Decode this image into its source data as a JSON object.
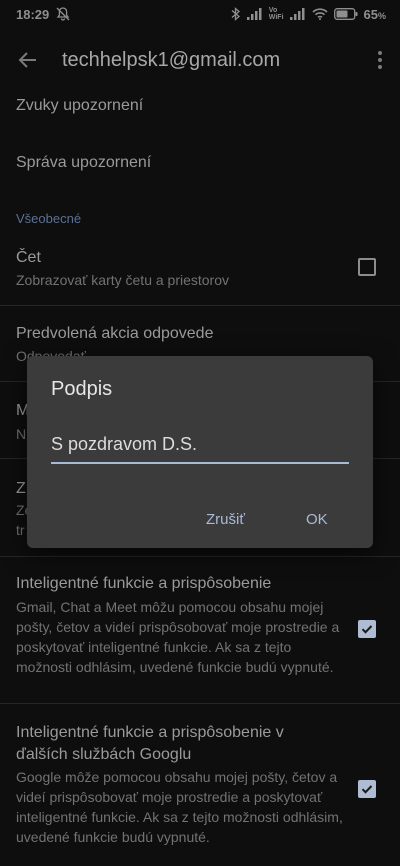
{
  "status_bar": {
    "time": "18:29",
    "icons": [
      "mute-bell-icon",
      "bluetooth-icon",
      "signal-icon",
      "vowifi-icon",
      "wifi-icon",
      "battery-icon"
    ],
    "battery_percent": "65",
    "battery_suffix": "%",
    "vowifi_label_1": "Vo",
    "vowifi_label_2": "WiFi"
  },
  "app_bar": {
    "title": "techhelpsk1@gmail.com"
  },
  "settings": {
    "notification_sounds": "Zvuky upozornení",
    "manage_notifications": "Správa upozornení",
    "section_general": "Všeobecné",
    "chat": {
      "title": "Čet",
      "subtitle": "Zobrazovať karty četu a priestorov",
      "checked": false
    },
    "default_reply": {
      "title": "Predvolená akcia odpovede",
      "subtitle": "Odpovedať"
    },
    "partial_m": "M",
    "partial_n": "N",
    "partial_z": "Z",
    "partial_ze": "Ze",
    "partial_tr": "tr",
    "smart_features": {
      "title": "Inteligentné funkcie a prispôsobenie",
      "subtitle": "Gmail, Chat a Meet môžu pomocou obsahu mojej pošty, četov a videí prispôsobovať moje prostredie a poskytovať inteligentné funkcie. Ak sa z tejto možnosti odhlásim, uvedené funkcie budú vypnuté.",
      "checked": true
    },
    "smart_features_google": {
      "title": "Inteligentné funkcie a prispôsobenie v ďalších službách Googlu",
      "subtitle": "Google môže pomocou obsahu mojej pošty, četov a videí prispôsobovať moje prostredie a poskytovať inteligentné funkcie. Ak sa z tejto možnosti odhlásim, uvedené funkcie budú vypnuté.",
      "checked": true
    }
  },
  "dialog": {
    "title": "Podpis",
    "input_value": "S pozdravom D.S.",
    "cancel_label": "Zrušiť",
    "ok_label": "OK"
  },
  "colors": {
    "accent": "#a9bad6",
    "dialog_bg": "#3b3b3b",
    "background": "#0e0e0e"
  }
}
